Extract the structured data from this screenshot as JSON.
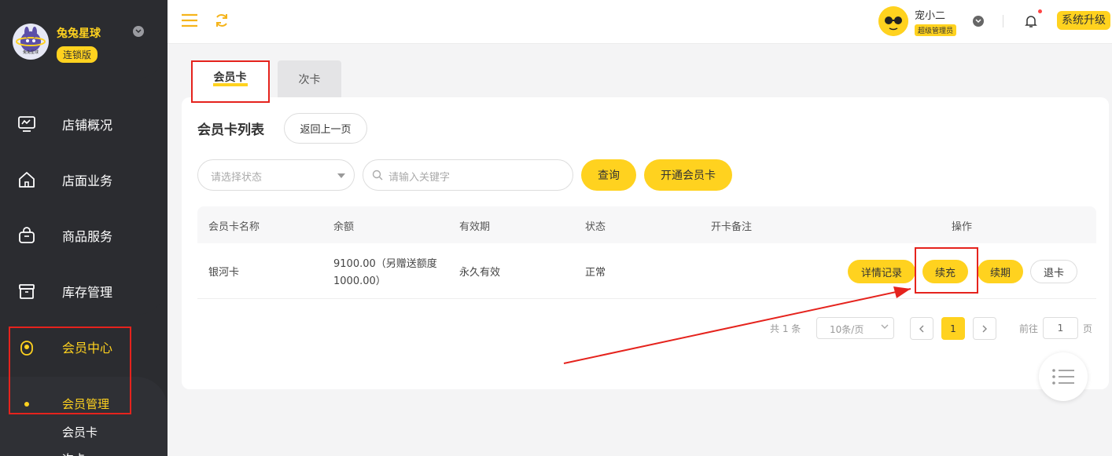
{
  "sidebar": {
    "brand_name": "兔兔星球",
    "edition": "连锁版",
    "logo_text": "兔兔星球",
    "menu": [
      {
        "label": "店铺概况",
        "icon": "monitor-icon"
      },
      {
        "label": "店面业务",
        "icon": "home-icon"
      },
      {
        "label": "商品服务",
        "icon": "bag-icon"
      },
      {
        "label": "库存管理",
        "icon": "box-icon"
      },
      {
        "label": "会员中心",
        "icon": "member-icon"
      }
    ],
    "submenu": {
      "group": "会员管理",
      "items": [
        "会员卡",
        "次卡"
      ]
    }
  },
  "header": {
    "user_name": "宠小二",
    "user_role": "超级管理员",
    "upgrade_label": "系统升级"
  },
  "tabs": [
    {
      "label": "会员卡",
      "active": true
    },
    {
      "label": "次卡",
      "active": false
    }
  ],
  "page": {
    "title": "会员卡列表",
    "back_label": "返回上一页"
  },
  "filters": {
    "status_placeholder": "请选择状态",
    "keyword_placeholder": "请输入关键字",
    "query_label": "查询",
    "open_card_label": "开通会员卡"
  },
  "table": {
    "columns": [
      "会员卡名称",
      "余额",
      "有效期",
      "状态",
      "开卡备注",
      "操作"
    ],
    "rows": [
      {
        "name": "银河卡",
        "balance_line1": "9100.00（另赠送额度",
        "balance_line2": "1000.00）",
        "validity": "永久有效",
        "status": "正常",
        "remark": "",
        "actions": [
          "详情记录",
          "续充",
          "续期",
          "退卡"
        ]
      }
    ]
  },
  "pagination": {
    "total": "共 1 条",
    "page_size": "10条/页",
    "current_page": "1",
    "goto_prefix": "前往",
    "goto_value": "1",
    "goto_suffix": "页"
  },
  "colors": {
    "accent": "#ffd21f",
    "sidebar_bg": "#2b2c30",
    "annotation_red": "#e5231d"
  }
}
